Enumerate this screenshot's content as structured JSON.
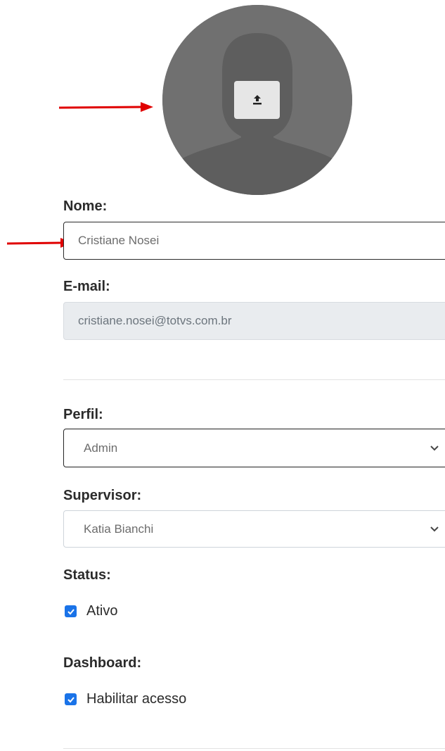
{
  "profile": {
    "avatar_icon": "person-silhouette-icon",
    "upload_icon": "upload-icon"
  },
  "form": {
    "name_label": "Nome:",
    "name_value": "Cristiane Nosei",
    "email_label": "E-mail:",
    "email_value": "cristiane.nosei@totvs.com.br",
    "perfil_label": "Perfil:",
    "perfil_selected": "Admin",
    "supervisor_label": "Supervisor:",
    "supervisor_selected": "Katia Bianchi",
    "status_label": "Status:",
    "status_checkbox_label": "Ativo",
    "status_checked": true,
    "dashboard_label": "Dashboard:",
    "dashboard_checkbox_label": "Habilitar acesso",
    "dashboard_checked": true
  },
  "colors": {
    "annotation_arrow": "#e00000",
    "checkbox_blue": "#1a73e8",
    "avatar_bg": "#707070"
  }
}
